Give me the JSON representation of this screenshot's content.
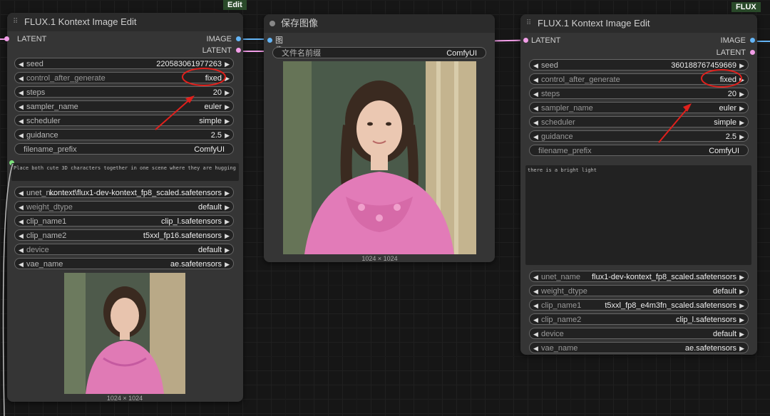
{
  "canvas": {
    "tab_edit": "Edit",
    "tab_flux": "FLUX"
  },
  "left_node": {
    "title": "FLUX.1 Kontext Image Edit",
    "input_latent": "LATENT",
    "output_image": "IMAGE",
    "output_latent": "LATENT",
    "widgets": [
      {
        "label": "seed",
        "value": "220583061977263"
      },
      {
        "label": "control_after_generate",
        "value": "fixed"
      },
      {
        "label": "steps",
        "value": "20"
      },
      {
        "label": "sampler_name",
        "value": "euler"
      },
      {
        "label": "scheduler",
        "value": "simple"
      },
      {
        "label": "guidance",
        "value": "2.5"
      },
      {
        "label": "filename_prefix",
        "value": "ComfyUI"
      }
    ],
    "prompt_text": "Place both cute 3D characters together in one scene where they are hugging",
    "model_widgets": [
      {
        "label": "unet_n...",
        "value": "kontext\\flux1-dev-kontext_fp8_scaled.safetensors"
      },
      {
        "label": "weight_dtype",
        "value": "default"
      },
      {
        "label": "clip_name1",
        "value": "clip_l.safetensors"
      },
      {
        "label": "clip_name2",
        "value": "t5xxl_fp16.safetensors"
      },
      {
        "label": "device",
        "value": "default"
      },
      {
        "label": "vae_name",
        "value": "ae.safetensors"
      }
    ],
    "image_size": "1024 × 1024"
  },
  "middle_node": {
    "title": "保存图像",
    "input_image": "图像",
    "prefix_label": "文件名前缀",
    "prefix_value": "ComfyUI",
    "image_size": "1024 × 1024"
  },
  "right_node": {
    "title": "FLUX.1 Kontext Image Edit",
    "input_latent": "LATENT",
    "output_image": "IMAGE",
    "output_latent": "LATENT",
    "widgets": [
      {
        "label": "seed",
        "value": "360188767459669"
      },
      {
        "label": "control_after_generate",
        "value": "fixed"
      },
      {
        "label": "steps",
        "value": "20"
      },
      {
        "label": "sampler_name",
        "value": "euler"
      },
      {
        "label": "scheduler",
        "value": "simple"
      },
      {
        "label": "guidance",
        "value": "2.5"
      },
      {
        "label": "filename_prefix",
        "value": "ComfyUI"
      }
    ],
    "prompt_text": "there is a bright light",
    "model_widgets": [
      {
        "label": "unet_name",
        "value": "flux1-dev-kontext_fp8_scaled.safetensors"
      },
      {
        "label": "weight_dtype",
        "value": "default"
      },
      {
        "label": "clip_name1",
        "value": "t5xxl_fp8_e4m3fn_scaled.safetensors"
      },
      {
        "label": "clip_name2",
        "value": "clip_l.safetensors"
      },
      {
        "label": "device",
        "value": "default"
      },
      {
        "label": "vae_name",
        "value": "ae.safetensors"
      }
    ]
  },
  "colors": {
    "latent": "#f29ee8",
    "image": "#64b5f6",
    "annotation": "#e0201c"
  }
}
